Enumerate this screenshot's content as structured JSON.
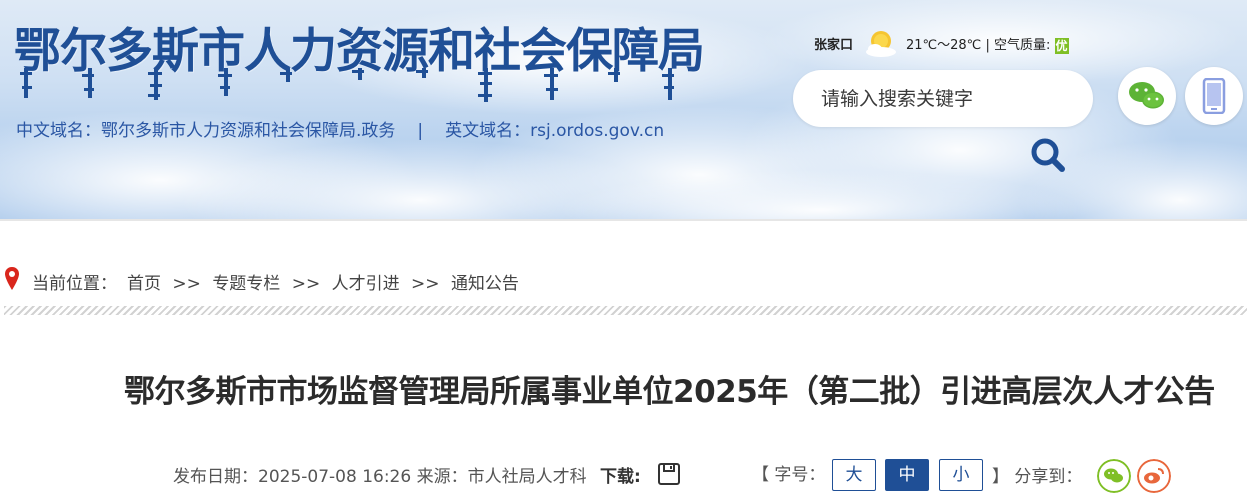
{
  "header": {
    "site_title": "鄂尔多斯市人力资源和社会保障局",
    "cn_domain": "中文域名：鄂尔多斯市人力资源和社会保障局.政务",
    "separator": "|",
    "en_domain": "英文域名：rsj.ordos.gov.cn",
    "weather": {
      "city": "张家口",
      "temperature": "21℃～28℃",
      "divider": "|",
      "air_quality_label": "空气质量:",
      "air_quality_value": "优",
      "icon": "sun-cloud-icon"
    },
    "search": {
      "placeholder": "请输入搜索关键字",
      "icon": "search-icon"
    },
    "buttons": {
      "wechat_icon": "wechat-icon",
      "mobile_icon": "mobile-icon"
    }
  },
  "breadcrumb": {
    "label": "当前位置：",
    "items": [
      "首页",
      "专题专栏",
      "人才引进",
      "通知公告"
    ],
    "separator": ">>"
  },
  "article": {
    "title": "鄂尔多斯市市场监督管理局所属事业单位2025年（第二批）引进高层次人才公告",
    "publish_date": "发布日期：2025-07-08 16:26",
    "source": "来源：市人社局人才科",
    "download_label": "下载:",
    "font_size_open": "【 字号：",
    "font_sizes": [
      "大",
      "中",
      "小"
    ],
    "font_size_selected": "中",
    "font_size_close": "】",
    "share_label": "分享到：",
    "share_targets": [
      "微信",
      "微博"
    ]
  },
  "colors": {
    "brand_blue": "#1f4f96",
    "wechat_green": "#7fbf26",
    "weibo_orange": "#e8673c",
    "location_red": "#d9261c"
  }
}
